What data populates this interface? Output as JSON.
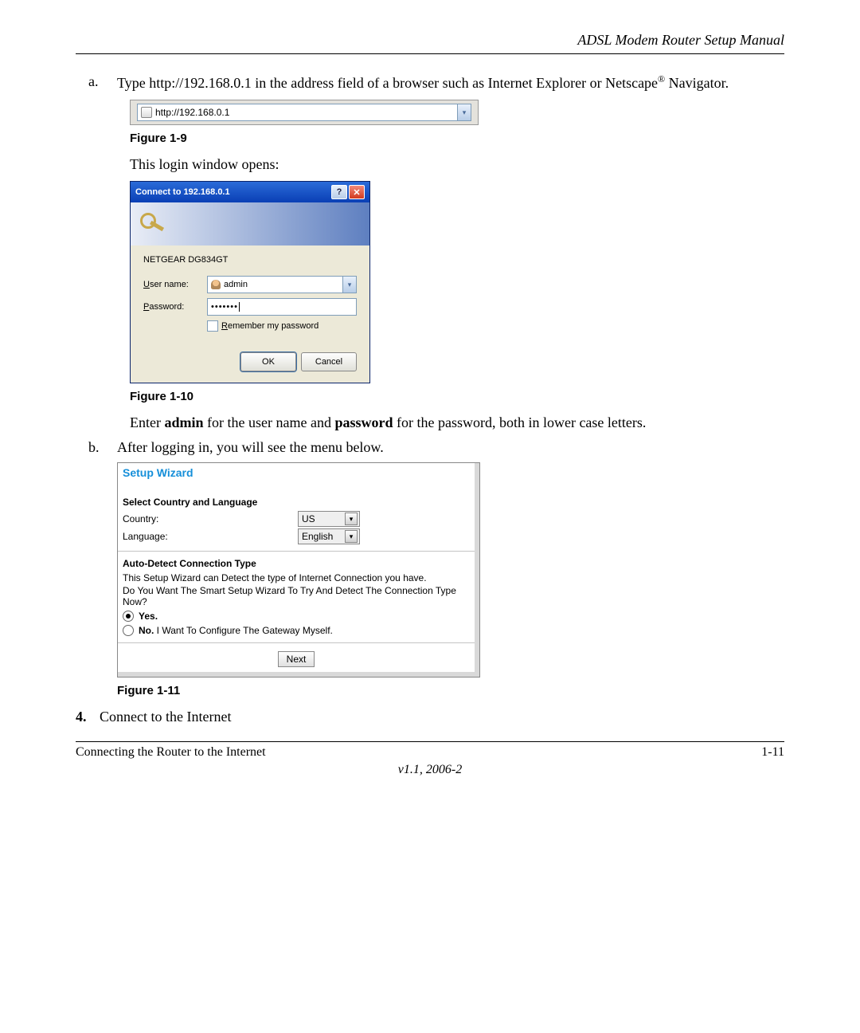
{
  "header": {
    "title": "ADSL Modem Router Setup Manual"
  },
  "items": {
    "a": {
      "marker": "a.",
      "text_before": "Type http://192.168.0.1 in the address field of a browser such as Internet Explorer or Netscape",
      "reg": "®",
      "text_after": " Navigator."
    },
    "b": {
      "marker": "b.",
      "text": "After logging in, you will see the menu below."
    }
  },
  "addressbar": {
    "url": "http://192.168.0.1"
  },
  "figures": {
    "f9": "Figure 1-9",
    "f10": "Figure 1-10",
    "f11": "Figure 1-11"
  },
  "login_intro": "This login window opens:",
  "dialog": {
    "title": "Connect to 192.168.0.1",
    "device": "NETGEAR DG834GT",
    "user_label": "User name:",
    "user_underline": "U",
    "user_value": "admin",
    "pass_label": "Password:",
    "pass_underline": "P",
    "pass_value": "•••••••",
    "remember": "Remember my password",
    "remember_underline": "R",
    "ok": "OK",
    "cancel": "Cancel"
  },
  "enter_line": {
    "pre": "Enter ",
    "admin": "admin",
    "mid": " for the user name and ",
    "password": "password",
    "post": " for the password, both in lower case letters."
  },
  "wizard": {
    "title": "Setup Wizard",
    "section1": "Select Country and Language",
    "country_label": "Country:",
    "country_value": "US",
    "language_label": "Language:",
    "language_value": "English",
    "section2": "Auto-Detect Connection Type",
    "desc1": "This Setup Wizard can Detect the type of Internet Connection you have.",
    "desc2": "Do You Want The Smart Setup Wizard To Try And Detect The Connection Type Now?",
    "yes": "Yes.",
    "no_bold": "No.",
    "no_rest": " I Want To Configure The Gateway Myself.",
    "next": "Next"
  },
  "step4": {
    "num": "4.",
    "text": "Connect to the Internet"
  },
  "footer": {
    "left": "Connecting the Router to the Internet",
    "right": "1-11",
    "version": "v1.1, 2006-2"
  }
}
